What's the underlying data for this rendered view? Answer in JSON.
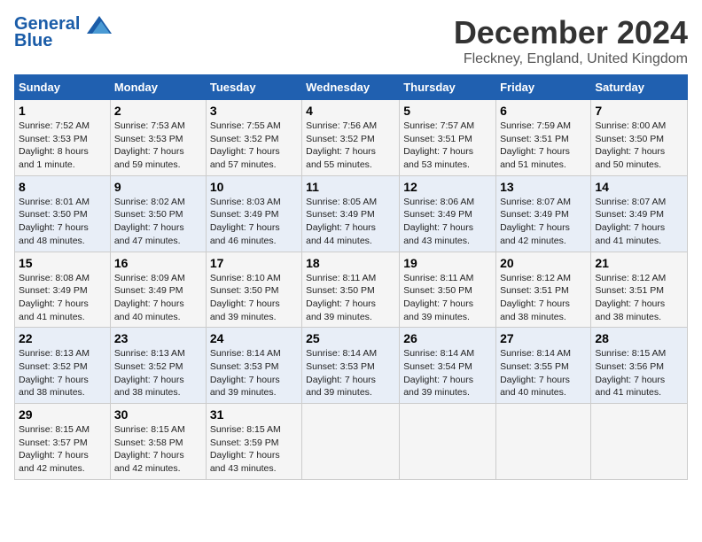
{
  "header": {
    "logo_line1": "General",
    "logo_line2": "Blue",
    "month_title": "December 2024",
    "location": "Fleckney, England, United Kingdom"
  },
  "weekdays": [
    "Sunday",
    "Monday",
    "Tuesday",
    "Wednesday",
    "Thursday",
    "Friday",
    "Saturday"
  ],
  "weeks": [
    [
      {
        "day": "1",
        "detail": "Sunrise: 7:52 AM\nSunset: 3:53 PM\nDaylight: 8 hours\nand 1 minute."
      },
      {
        "day": "2",
        "detail": "Sunrise: 7:53 AM\nSunset: 3:53 PM\nDaylight: 7 hours\nand 59 minutes."
      },
      {
        "day": "3",
        "detail": "Sunrise: 7:55 AM\nSunset: 3:52 PM\nDaylight: 7 hours\nand 57 minutes."
      },
      {
        "day": "4",
        "detail": "Sunrise: 7:56 AM\nSunset: 3:52 PM\nDaylight: 7 hours\nand 55 minutes."
      },
      {
        "day": "5",
        "detail": "Sunrise: 7:57 AM\nSunset: 3:51 PM\nDaylight: 7 hours\nand 53 minutes."
      },
      {
        "day": "6",
        "detail": "Sunrise: 7:59 AM\nSunset: 3:51 PM\nDaylight: 7 hours\nand 51 minutes."
      },
      {
        "day": "7",
        "detail": "Sunrise: 8:00 AM\nSunset: 3:50 PM\nDaylight: 7 hours\nand 50 minutes."
      }
    ],
    [
      {
        "day": "8",
        "detail": "Sunrise: 8:01 AM\nSunset: 3:50 PM\nDaylight: 7 hours\nand 48 minutes."
      },
      {
        "day": "9",
        "detail": "Sunrise: 8:02 AM\nSunset: 3:50 PM\nDaylight: 7 hours\nand 47 minutes."
      },
      {
        "day": "10",
        "detail": "Sunrise: 8:03 AM\nSunset: 3:49 PM\nDaylight: 7 hours\nand 46 minutes."
      },
      {
        "day": "11",
        "detail": "Sunrise: 8:05 AM\nSunset: 3:49 PM\nDaylight: 7 hours\nand 44 minutes."
      },
      {
        "day": "12",
        "detail": "Sunrise: 8:06 AM\nSunset: 3:49 PM\nDaylight: 7 hours\nand 43 minutes."
      },
      {
        "day": "13",
        "detail": "Sunrise: 8:07 AM\nSunset: 3:49 PM\nDaylight: 7 hours\nand 42 minutes."
      },
      {
        "day": "14",
        "detail": "Sunrise: 8:07 AM\nSunset: 3:49 PM\nDaylight: 7 hours\nand 41 minutes."
      }
    ],
    [
      {
        "day": "15",
        "detail": "Sunrise: 8:08 AM\nSunset: 3:49 PM\nDaylight: 7 hours\nand 41 minutes."
      },
      {
        "day": "16",
        "detail": "Sunrise: 8:09 AM\nSunset: 3:49 PM\nDaylight: 7 hours\nand 40 minutes."
      },
      {
        "day": "17",
        "detail": "Sunrise: 8:10 AM\nSunset: 3:50 PM\nDaylight: 7 hours\nand 39 minutes."
      },
      {
        "day": "18",
        "detail": "Sunrise: 8:11 AM\nSunset: 3:50 PM\nDaylight: 7 hours\nand 39 minutes."
      },
      {
        "day": "19",
        "detail": "Sunrise: 8:11 AM\nSunset: 3:50 PM\nDaylight: 7 hours\nand 39 minutes."
      },
      {
        "day": "20",
        "detail": "Sunrise: 8:12 AM\nSunset: 3:51 PM\nDaylight: 7 hours\nand 38 minutes."
      },
      {
        "day": "21",
        "detail": "Sunrise: 8:12 AM\nSunset: 3:51 PM\nDaylight: 7 hours\nand 38 minutes."
      }
    ],
    [
      {
        "day": "22",
        "detail": "Sunrise: 8:13 AM\nSunset: 3:52 PM\nDaylight: 7 hours\nand 38 minutes."
      },
      {
        "day": "23",
        "detail": "Sunrise: 8:13 AM\nSunset: 3:52 PM\nDaylight: 7 hours\nand 38 minutes."
      },
      {
        "day": "24",
        "detail": "Sunrise: 8:14 AM\nSunset: 3:53 PM\nDaylight: 7 hours\nand 39 minutes."
      },
      {
        "day": "25",
        "detail": "Sunrise: 8:14 AM\nSunset: 3:53 PM\nDaylight: 7 hours\nand 39 minutes."
      },
      {
        "day": "26",
        "detail": "Sunrise: 8:14 AM\nSunset: 3:54 PM\nDaylight: 7 hours\nand 39 minutes."
      },
      {
        "day": "27",
        "detail": "Sunrise: 8:14 AM\nSunset: 3:55 PM\nDaylight: 7 hours\nand 40 minutes."
      },
      {
        "day": "28",
        "detail": "Sunrise: 8:15 AM\nSunset: 3:56 PM\nDaylight: 7 hours\nand 41 minutes."
      }
    ],
    [
      {
        "day": "29",
        "detail": "Sunrise: 8:15 AM\nSunset: 3:57 PM\nDaylight: 7 hours\nand 42 minutes."
      },
      {
        "day": "30",
        "detail": "Sunrise: 8:15 AM\nSunset: 3:58 PM\nDaylight: 7 hours\nand 42 minutes."
      },
      {
        "day": "31",
        "detail": "Sunrise: 8:15 AM\nSunset: 3:59 PM\nDaylight: 7 hours\nand 43 minutes."
      },
      null,
      null,
      null,
      null
    ]
  ]
}
